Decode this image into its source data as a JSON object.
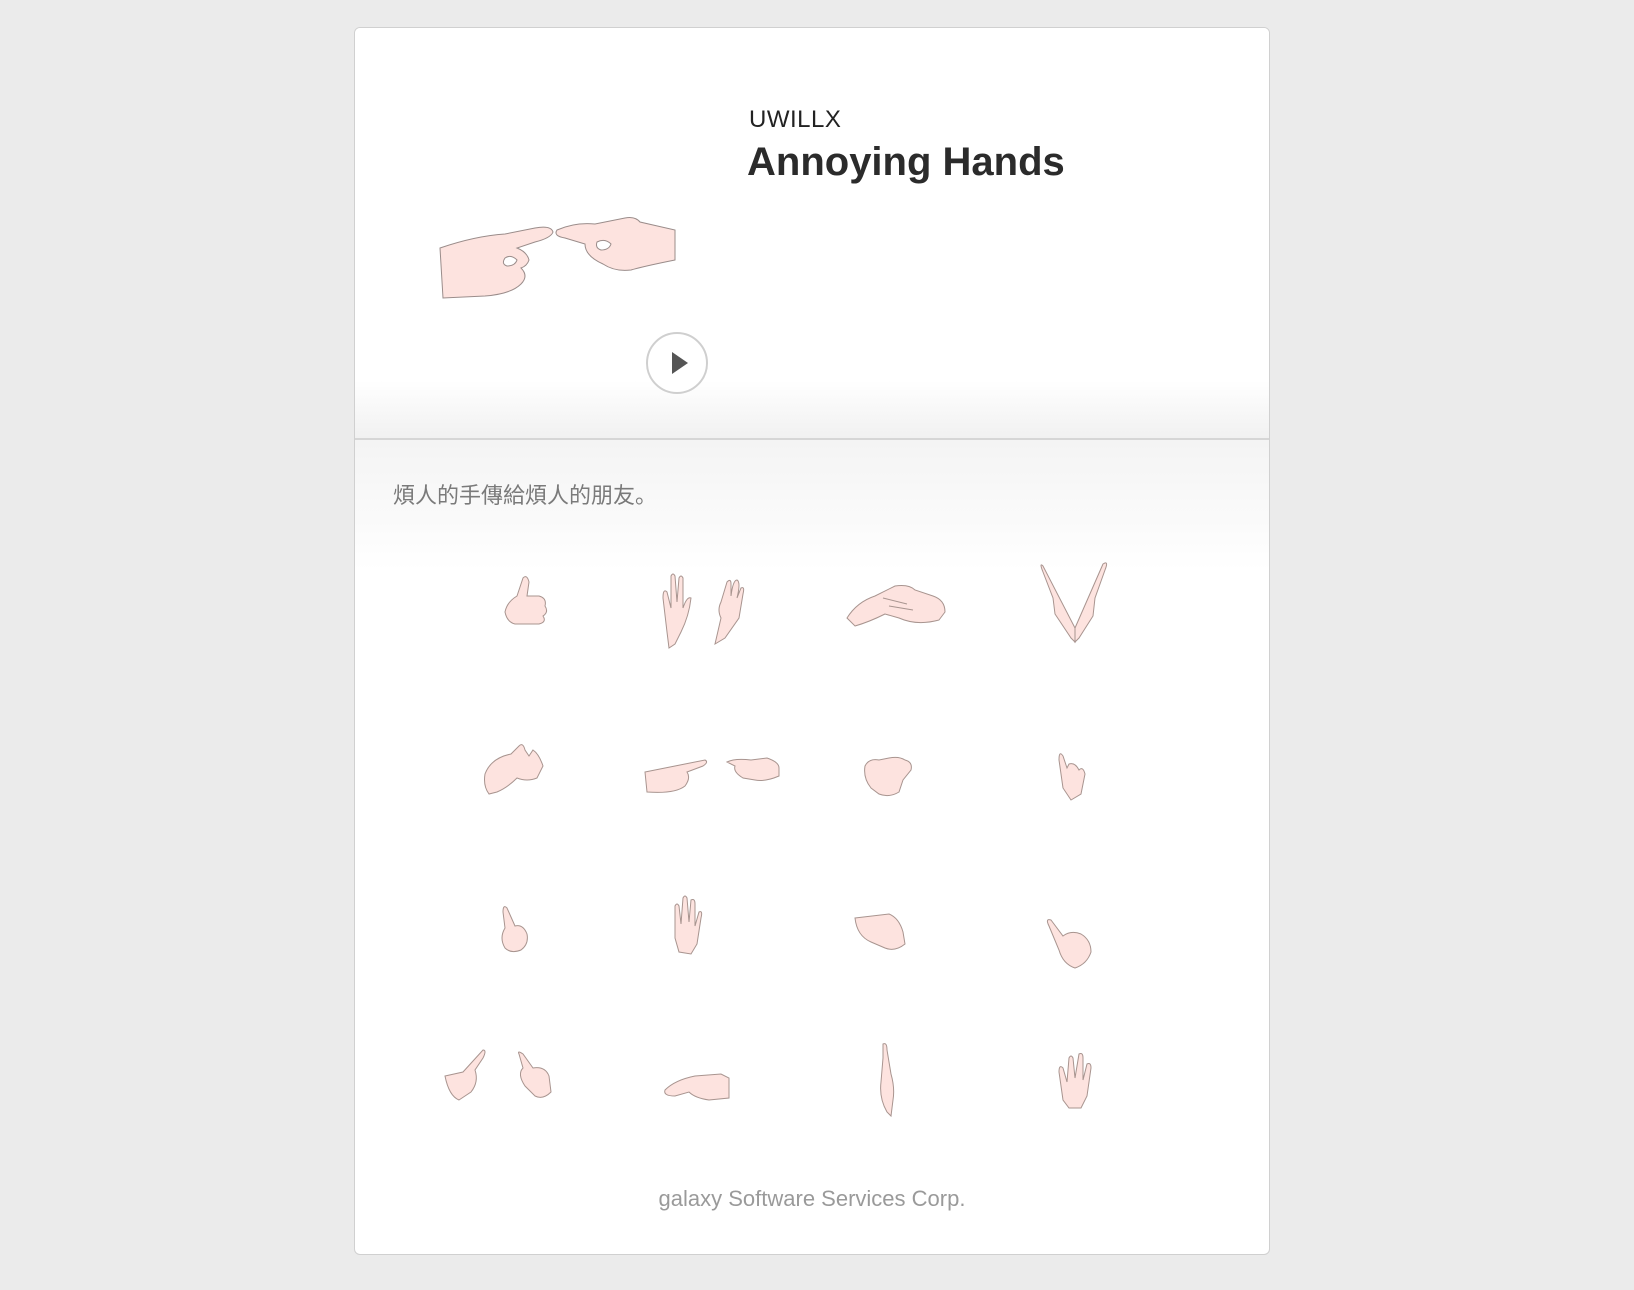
{
  "app": {
    "developer": "UWILLX",
    "title": "Annoying Hands",
    "description": "煩人的手傳給煩人的朋友。",
    "footer": "galaxy Software Services Corp."
  },
  "controls": {
    "play_icon": "play-icon"
  },
  "gestures": [
    "thumbs-up-icon",
    "two-open-hands-icon",
    "handshake-icon",
    "praying-hands-icon",
    "hand-gun-icon",
    "two-pointing-hands-icon",
    "fist-icon",
    "rock-on-icon",
    "index-finger-up-icon",
    "open-palm-icon",
    "closed-fist-icon",
    "pointing-down-icon",
    "two-fingers-pointing-icon",
    "palm-down-icon",
    "single-finger-icon",
    "raised-hand-icon"
  ],
  "colors": {
    "skin": "#fde3df",
    "outline": "#9a8c8a",
    "background": "#ebebeb"
  }
}
